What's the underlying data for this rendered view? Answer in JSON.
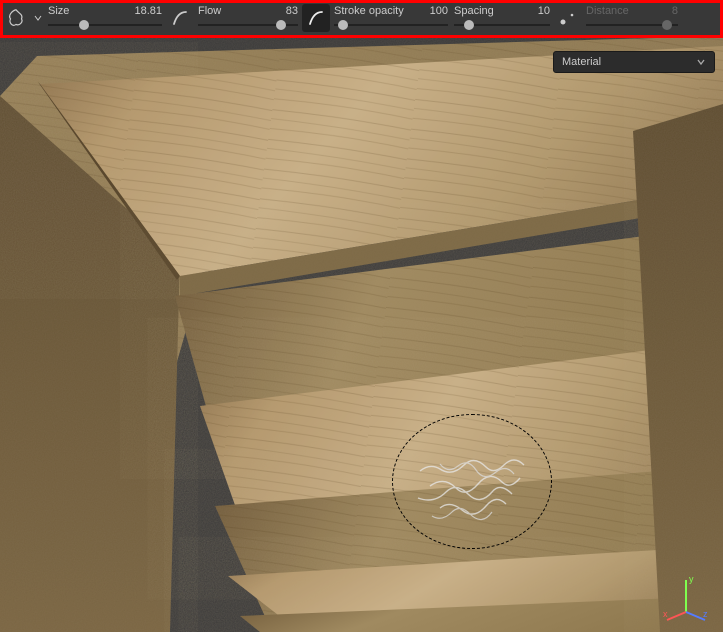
{
  "toolbar": {
    "size": {
      "label": "Size",
      "value": "18.81",
      "percent": 32
    },
    "flow": {
      "label": "Flow",
      "value": "83",
      "percent": 83
    },
    "stroke_opacity": {
      "label": "Stroke opacity",
      "value": "100",
      "percent": 8
    },
    "spacing": {
      "label": "Spacing",
      "value": "10",
      "percent": 16
    },
    "distance": {
      "label": "Distance",
      "value": "8",
      "percent": 88
    }
  },
  "dropdown": {
    "selected": "Material"
  },
  "gizmo": {
    "x": "x",
    "y": "y",
    "z": "z"
  }
}
